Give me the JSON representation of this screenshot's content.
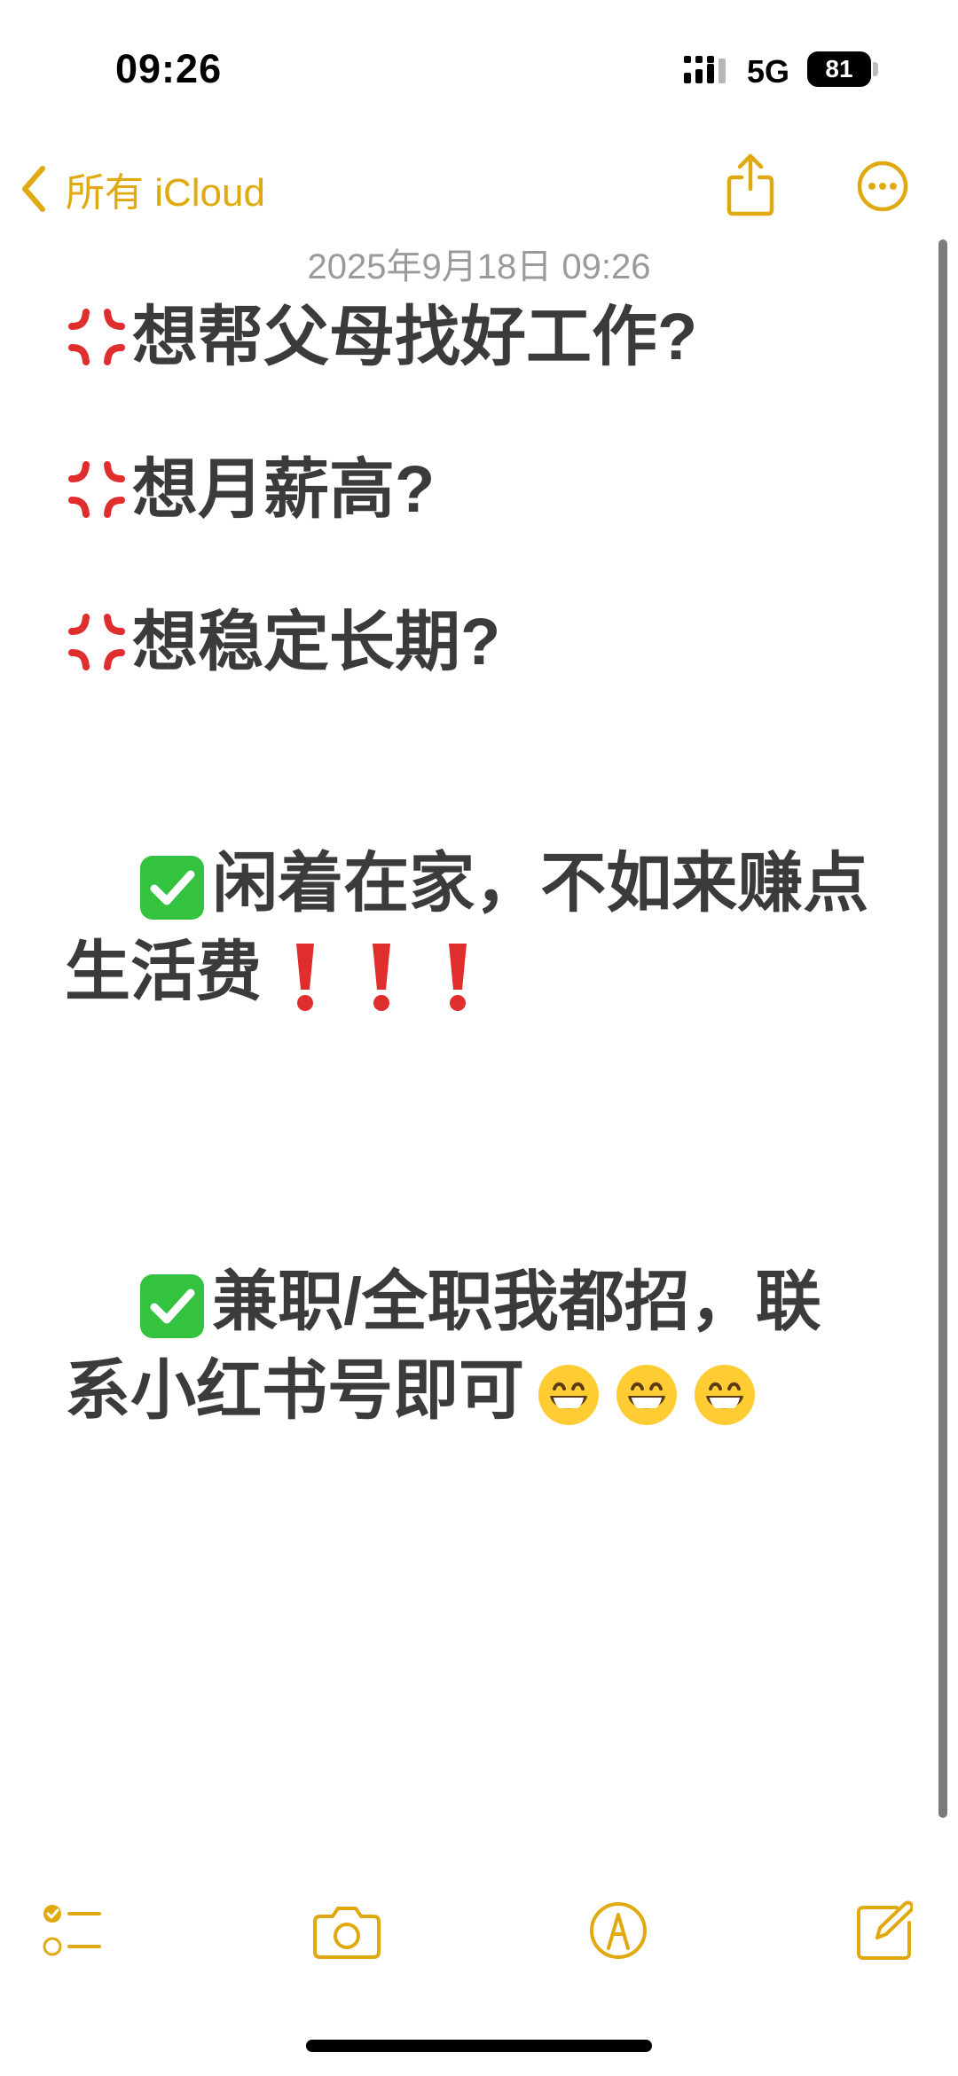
{
  "status_bar": {
    "time": "09:26",
    "network": "5G",
    "battery": "81"
  },
  "nav": {
    "back_label": "所有 iCloud",
    "accent": "#e0a90f"
  },
  "note": {
    "date": "2025年9月18日 09:26",
    "lines": [
      {
        "emoji": "anger-icon",
        "text": "想帮父母找好工作?"
      },
      {
        "emoji": "anger-icon",
        "text": "想月薪高?"
      },
      {
        "emoji": "anger-icon",
        "text": "想稳定长期?"
      },
      {
        "emoji": "check-icon",
        "text": "闲着在家，不如来赚点生活费",
        "trailing": "exclamation-icon x3"
      },
      {
        "emoji": "check-icon",
        "text": "兼职/全职我都招，联系小红书号即可",
        "trailing": "grin-icon x3"
      }
    ]
  },
  "toolbar": {
    "items": [
      "checklist-icon",
      "camera-icon",
      "markup-icon",
      "compose-icon"
    ]
  }
}
